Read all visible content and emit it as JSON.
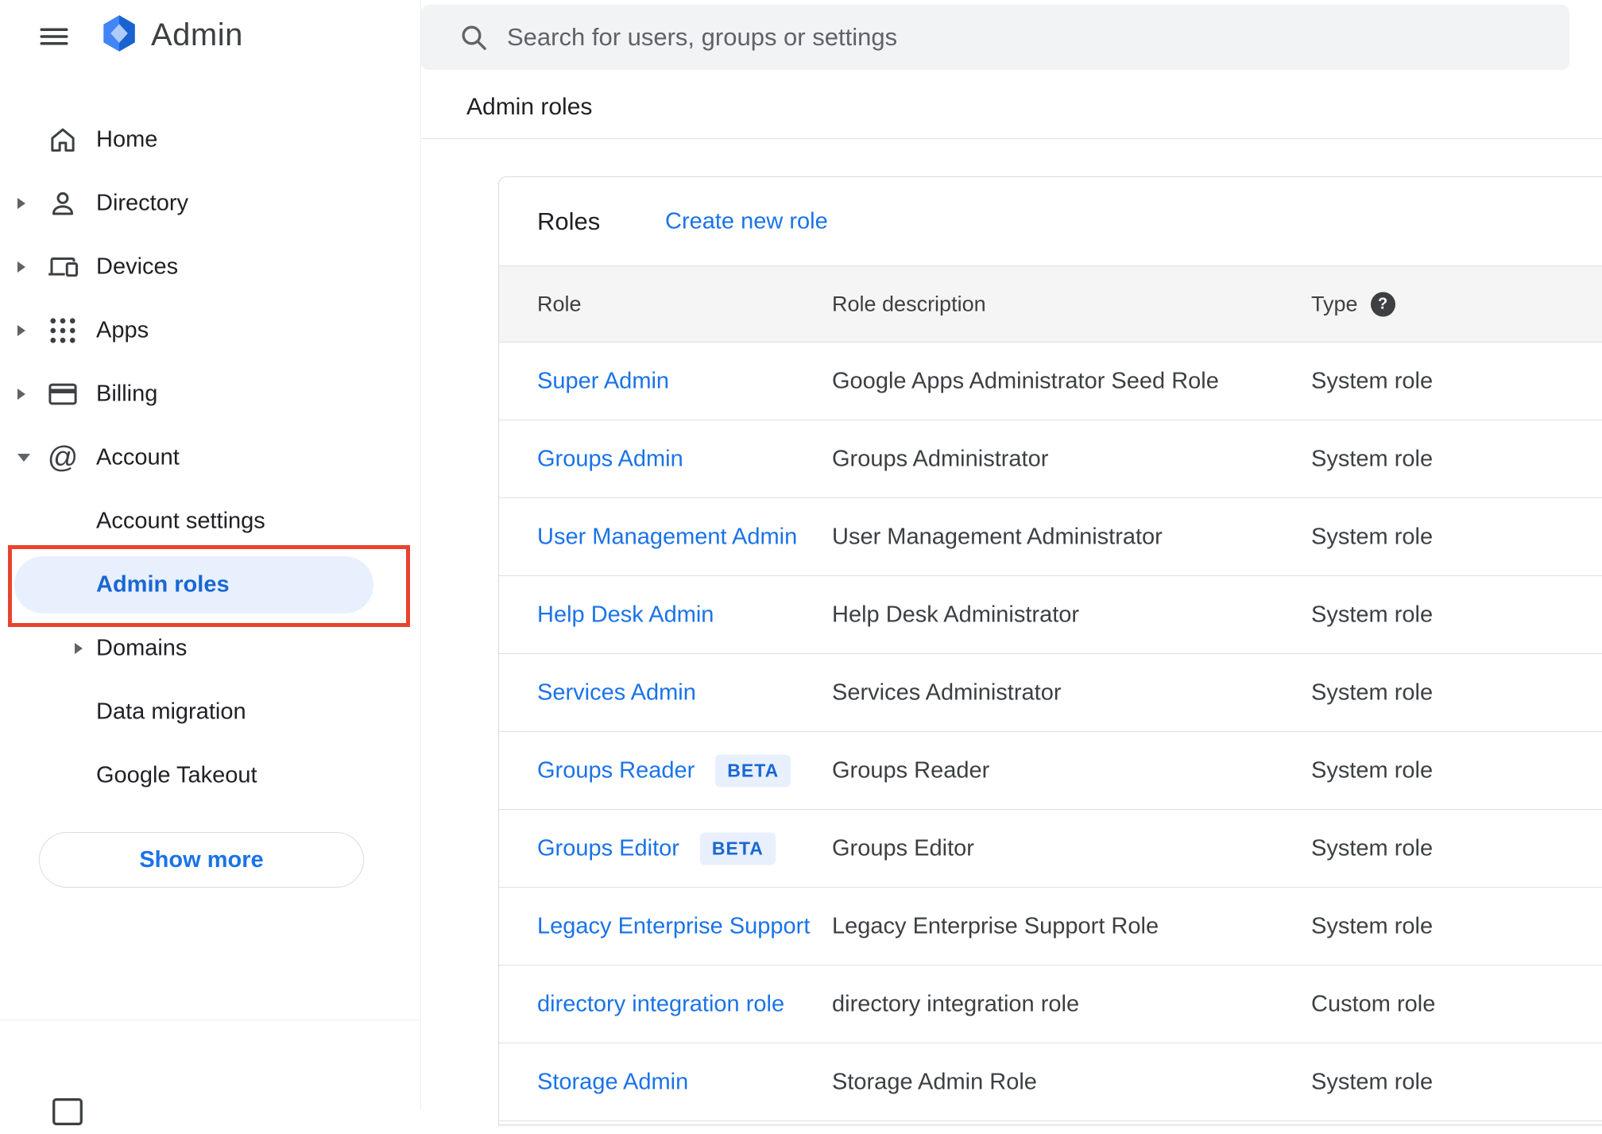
{
  "app": {
    "product_name": "Admin"
  },
  "header": {
    "search_placeholder": "Search for users, groups or settings"
  },
  "breadcrumb": "Admin roles",
  "sidebar": {
    "items": [
      {
        "label": "Home",
        "icon": "home-icon",
        "level": 0,
        "expandable": false
      },
      {
        "label": "Directory",
        "icon": "directory-icon",
        "level": 0,
        "expandable": true
      },
      {
        "label": "Devices",
        "icon": "devices-icon",
        "level": 0,
        "expandable": true
      },
      {
        "label": "Apps",
        "icon": "apps-icon",
        "level": 0,
        "expandable": true
      },
      {
        "label": "Billing",
        "icon": "billing-icon",
        "level": 0,
        "expandable": true
      },
      {
        "label": "Account",
        "icon": "account-icon",
        "level": 0,
        "expandable": true,
        "expanded": true
      },
      {
        "label": "Account settings",
        "level": 1
      },
      {
        "label": "Admin roles",
        "level": 1,
        "selected": true,
        "annotated": true
      },
      {
        "label": "Domains",
        "level": 1,
        "expandable": true
      },
      {
        "label": "Data migration",
        "level": 1
      },
      {
        "label": "Google Takeout",
        "level": 1
      }
    ],
    "show_more_label": "Show more"
  },
  "roles": {
    "title": "Roles",
    "create_link": "Create new role",
    "beta_label": "BETA",
    "columns": [
      "Role",
      "Role description",
      "Type"
    ],
    "rows": [
      {
        "role": "Super Admin",
        "beta": false,
        "description": "Google Apps Administrator Seed Role",
        "type": "System role"
      },
      {
        "role": "Groups Admin",
        "beta": false,
        "description": "Groups Administrator",
        "type": "System role"
      },
      {
        "role": "User Management Admin",
        "beta": false,
        "description": "User Management Administrator",
        "type": "System role"
      },
      {
        "role": "Help Desk Admin",
        "beta": false,
        "description": "Help Desk Administrator",
        "type": "System role"
      },
      {
        "role": "Services Admin",
        "beta": false,
        "description": "Services Administrator",
        "type": "System role"
      },
      {
        "role": "Groups Reader",
        "beta": true,
        "description": "Groups Reader",
        "type": "System role"
      },
      {
        "role": "Groups Editor",
        "beta": true,
        "description": "Groups Editor",
        "type": "System role"
      },
      {
        "role": "Legacy Enterprise Support",
        "beta": false,
        "description": "Legacy Enterprise Support Role",
        "type": "System role"
      },
      {
        "role": "directory integration role",
        "beta": false,
        "description": "directory integration role",
        "type": "Custom role"
      },
      {
        "role": "Storage Admin",
        "beta": false,
        "description": "Storage Admin Role",
        "type": "System role"
      }
    ]
  },
  "colors": {
    "accent": "#1a73e8",
    "selected_bg": "#e8f0fe",
    "selected_text": "#1967d2",
    "annotation_red": "#e8432e",
    "header_bg": "#f5f5f5",
    "search_bg": "#f1f3f4",
    "beta_bg": "#e8f0fe",
    "beta_text": "#1967d2",
    "divider": "#e0e0e0"
  }
}
